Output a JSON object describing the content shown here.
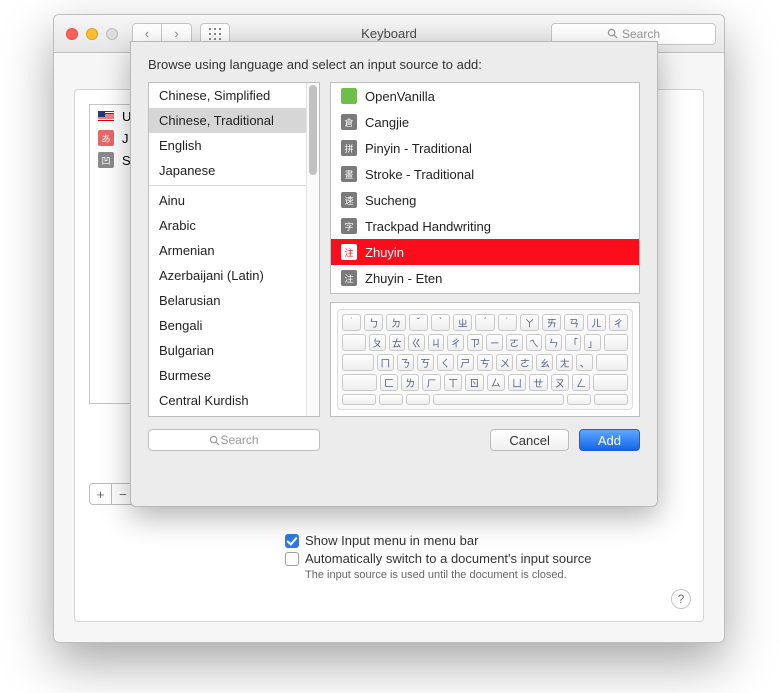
{
  "window": {
    "title": "Keyboard",
    "search_placeholder": "Search"
  },
  "existing_sources": [
    {
      "label": "U"
    },
    {
      "label": "J"
    },
    {
      "label": "S"
    }
  ],
  "options": {
    "show_menu": {
      "label": "Show Input menu in menu bar",
      "checked": true
    },
    "auto_switch": {
      "label": "Automatically switch to a document's input source",
      "checked": false
    },
    "note": "The input source is used until the document is closed."
  },
  "sheet": {
    "title": "Browse using language and select an input source to add:",
    "selected_language": "Chinese, Traditional",
    "languages_featured": [
      "Chinese, Simplified",
      "Chinese, Traditional",
      "English",
      "Japanese"
    ],
    "languages": [
      "Ainu",
      "Arabic",
      "Armenian",
      "Azerbaijani (Latin)",
      "Belarusian",
      "Bengali",
      "Bulgarian",
      "Burmese",
      "Central Kurdish"
    ],
    "selected_input": "Zhuyin",
    "inputs": [
      {
        "label": "OpenVanilla",
        "icon": "green",
        "glyph": ""
      },
      {
        "label": "Cangjie",
        "glyph": "倉"
      },
      {
        "label": "Pinyin - Traditional",
        "glyph": "拼"
      },
      {
        "label": "Stroke - Traditional",
        "glyph": "畫"
      },
      {
        "label": "Sucheng",
        "glyph": "速"
      },
      {
        "label": "Trackpad Handwriting",
        "glyph": "字"
      },
      {
        "label": "Zhuyin",
        "glyph": "注"
      },
      {
        "label": "Zhuyin - Eten",
        "glyph": "注"
      }
    ],
    "keyboard_rows": [
      [
        "˙",
        "ㄅ",
        "ㄉ",
        "ˇ",
        "ˋ",
        "ㄓ",
        "ˊ",
        "˙",
        "ㄚ",
        "ㄞ",
        "ㄢ",
        "ㄦ",
        "ㄔ"
      ],
      [
        "ㄆ",
        "ㄊ",
        "ㄍ",
        "ㄐ",
        "ㄔ",
        "ㄗ",
        "ㄧ",
        "ㄛ",
        "ㄟ",
        "ㄣ",
        "「",
        "」"
      ],
      [
        "ㄇ",
        "ㄋ",
        "ㄎ",
        "ㄑ",
        "ㄕ",
        "ㄘ",
        "ㄨ",
        "ㄜ",
        "ㄠ",
        "ㄤ",
        "、"
      ],
      [
        "ㄈ",
        "ㄌ",
        "ㄏ",
        "ㄒ",
        "ㄖ",
        "ㄙ",
        "ㄩ",
        "ㄝ",
        "ㄡ",
        "ㄥ"
      ]
    ],
    "search_placeholder": "Search",
    "cancel": "Cancel",
    "add": "Add"
  }
}
